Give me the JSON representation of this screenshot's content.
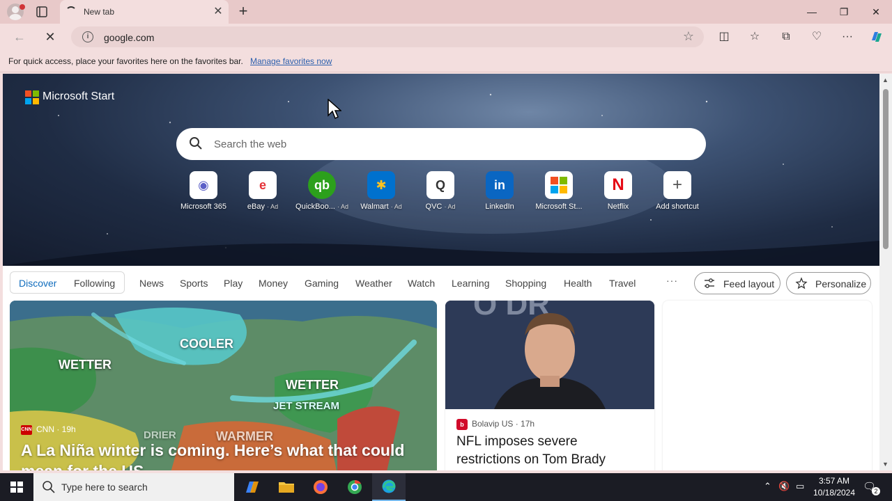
{
  "browser": {
    "tab_title": "New tab",
    "url": "google.com",
    "favorites_hint": "For quick access, place your favorites here on the favorites bar.",
    "favorites_link": "Manage favorites now"
  },
  "page": {
    "brand": "Microsoft Start",
    "search_placeholder": "Search the web",
    "shortcuts": [
      {
        "label": "Microsoft 365",
        "ad": "",
        "icon": "microsoft365-icon",
        "color": "#5b5fc7"
      },
      {
        "label": "eBay",
        "ad": "· Ad",
        "icon": "ebay-icon",
        "color": "#e53238"
      },
      {
        "label": "QuickBoo...",
        "ad": "· Ad",
        "icon": "quickbooks-icon",
        "color": "#2ca01c"
      },
      {
        "label": "Walmart",
        "ad": "· Ad",
        "icon": "walmart-icon",
        "color": "#0071ce"
      },
      {
        "label": "QVC",
        "ad": "· Ad",
        "icon": "qvc-icon",
        "color": "#333333"
      },
      {
        "label": "LinkedIn",
        "ad": "",
        "icon": "linkedin-icon",
        "color": "#0a66c2"
      },
      {
        "label": "Microsoft St...",
        "ad": "",
        "icon": "microsoft-store-icon",
        "color": "#f25022"
      },
      {
        "label": "Netflix",
        "ad": "",
        "icon": "netflix-icon",
        "color": "#e50914"
      },
      {
        "label": "Add shortcut",
        "ad": "",
        "icon": "plus-icon",
        "color": "#555555"
      }
    ],
    "feed_tabs": {
      "discover": "Discover",
      "following": "Following",
      "items": [
        "News",
        "Sports",
        "Play",
        "Money",
        "Gaming",
        "Weather",
        "Watch",
        "Learning",
        "Shopping",
        "Health",
        "Travel"
      ],
      "more": "···",
      "feed_layout": "Feed layout",
      "personalize": "Personalize"
    },
    "cards": {
      "big": {
        "source": "CNN",
        "time": "· 19h",
        "title": "A La Niña winter is coming. Here’s what that could mean for the US",
        "map_labels": {
          "cooler": "COOLER",
          "wetter_west": "WETTER",
          "wetter_east": "WETTER",
          "warmer": "WARMER",
          "drier": "DRIER",
          "jet_stream": "JET STREAM",
          "jet_stream_2": "JET STREAM",
          "drier_warmer": "DRIER & WARMER"
        }
      },
      "mid": {
        "source": "Bolavip US",
        "time": "· 17h",
        "title": "NFL imposes severe restrictions on Tom Brady"
      }
    }
  },
  "taskbar": {
    "search_placeholder": "Type here to search",
    "time": "3:57 AM",
    "date": "10/18/2024",
    "notifications": "2"
  }
}
